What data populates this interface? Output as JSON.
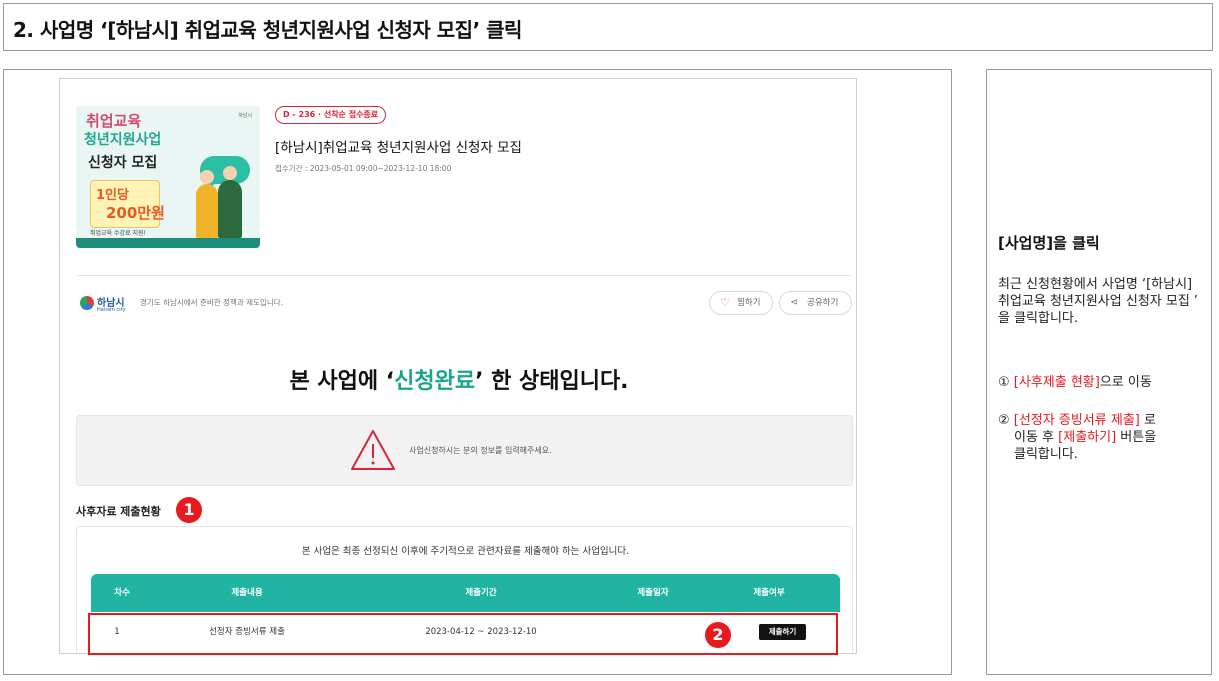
{
  "header": {
    "title": "2. 사업명 ‘[하남시] 취업교육 청년지원사업 신청자 모집’ 클릭"
  },
  "post": {
    "dday_badge": "D - 236  ·  선착순 접수종료",
    "title": "[하남시]취업교육 청년지원사업 신청자 모집",
    "period": "접수기간 : 2023-05-01 09:00~2023-12-10 18:00",
    "poster": {
      "line1": "취업교육",
      "line2": "청년지원사업",
      "line3": "신청자 모집",
      "badge1": "1인당",
      "badge2": "200만원",
      "footer": "취업교육 수강료 지원!"
    }
  },
  "org": {
    "name": "하남시",
    "sub": "Hanam city",
    "desc": "경기도 하남시에서 준비한 정책과 제도입니다."
  },
  "actions": {
    "like": "찜하기",
    "share": "공유하기"
  },
  "status": {
    "prefix": "본 사업에 ‘",
    "highlight": "신청완료",
    "suffix": "’ 한 상태입니다."
  },
  "warning": {
    "text": "사업신청하시는 분의 정보를 입력해주세요."
  },
  "report": {
    "section_title": "사후자료 제출현황",
    "description": "본 사업은 최종 선정되신 이후에 주기적으로 관련자료를 제출해야 하는 사업입니다.",
    "columns": [
      "차수",
      "제출내용",
      "제출기간",
      "제출일자",
      "제출여부"
    ],
    "rows": [
      {
        "round": "1",
        "content": "선정자 증빙서류 제출",
        "period": "2023-04-12 ~ 2023-12-10",
        "date": "",
        "button": "제출하기"
      }
    ]
  },
  "markers": {
    "one": "1",
    "two": "2"
  },
  "instructions": {
    "title": "[사업명]을 클릭",
    "desc": "최근 신청현황에서 사업명 ‘[하남시] 취업교육 청년지원사업 신청자 모집 ’ 을 클릭합니다.",
    "step1_num": "①",
    "step1_red": "[사후제출 현황]",
    "step1_rest": "으로 이동",
    "step2_num": "②",
    "step2_red1": "[선정자 증빙서류 제출]",
    "step2_mid": " 로",
    "step2_line2_a": "이동 후 ",
    "step2_red2": "[제출하기]",
    "step2_line2_b": " 버튼을",
    "step2_line3": "클릭합니다."
  },
  "colors": {
    "accent_teal": "#22b4a2",
    "marker_red": "#e8191f",
    "dday_red": "#d9253b"
  }
}
